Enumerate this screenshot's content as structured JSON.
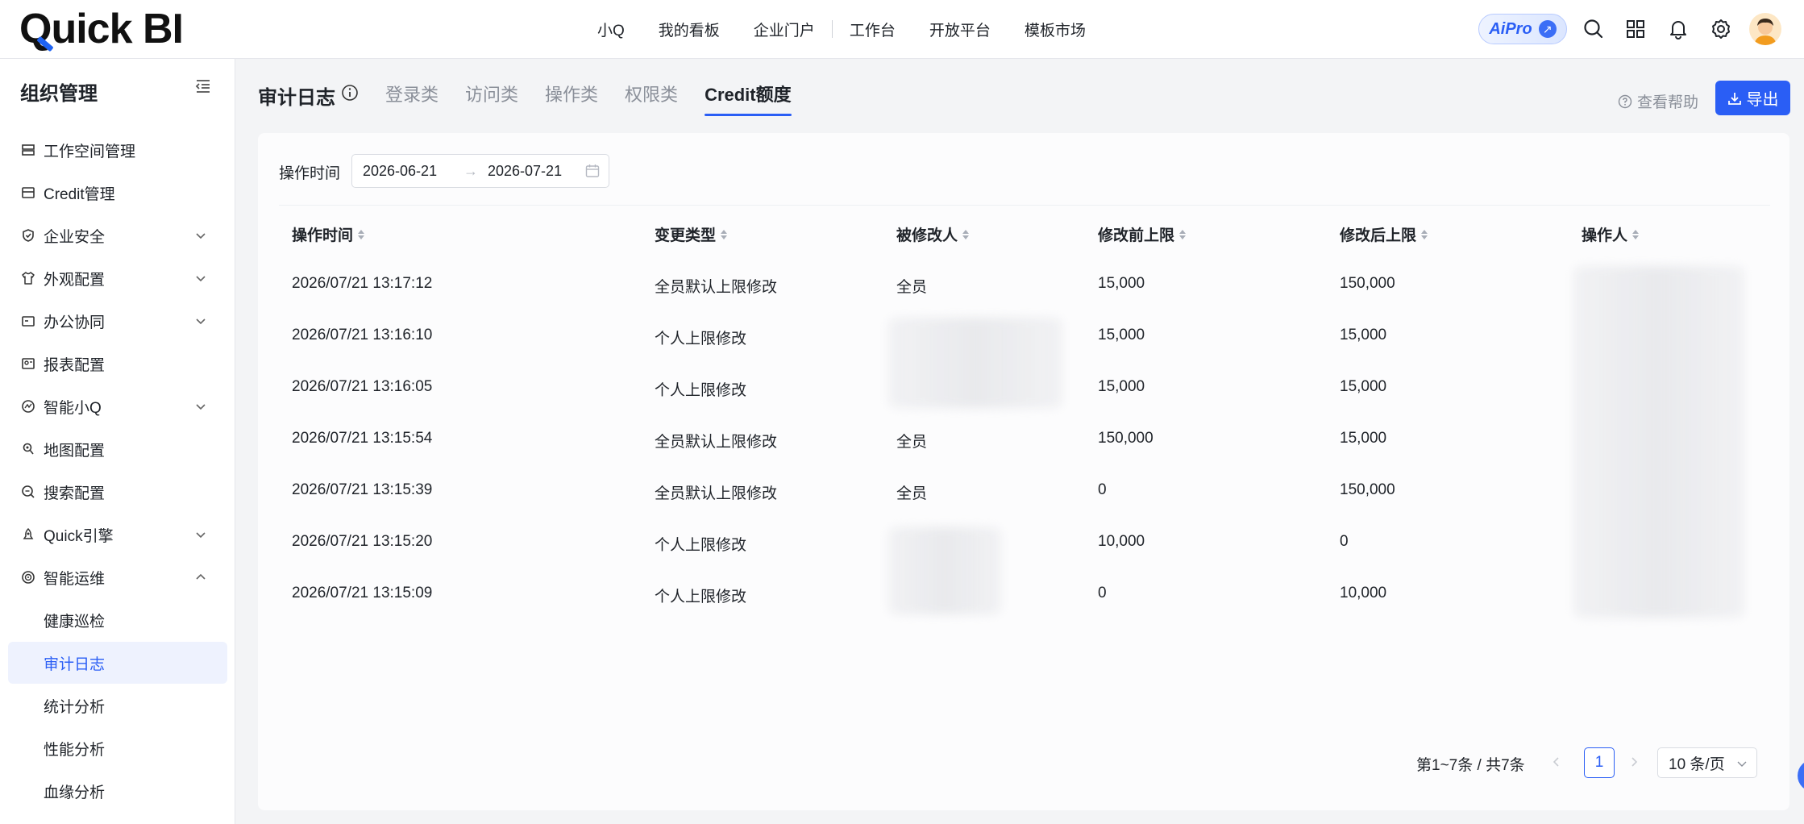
{
  "app": {
    "logo_text": "Quick BI",
    "logo_q": "Q",
    "logo_rest": "uick BI"
  },
  "topnav": {
    "items": [
      "小Q",
      "我的看板",
      "企业门户",
      "工作台",
      "开放平台",
      "模板市场"
    ],
    "ai_pro_label": "AiPro"
  },
  "sidebar": {
    "title": "组织管理",
    "items": [
      {
        "label": "工作空间管理",
        "icon": "workspace-icon",
        "expandable": false
      },
      {
        "label": "Credit管理",
        "icon": "credit-icon",
        "expandable": false
      },
      {
        "label": "企业安全",
        "icon": "shield-icon",
        "expandable": true
      },
      {
        "label": "外观配置",
        "icon": "shirt-icon",
        "expandable": true
      },
      {
        "label": "办公协同",
        "icon": "office-icon",
        "expandable": true
      },
      {
        "label": "报表配置",
        "icon": "report-icon",
        "expandable": false
      },
      {
        "label": "智能小Q",
        "icon": "ai-icon",
        "expandable": true
      },
      {
        "label": "地图配置",
        "icon": "map-pin-icon",
        "expandable": false
      },
      {
        "label": "搜索配置",
        "icon": "search-config-icon",
        "expandable": false
      },
      {
        "label": "Quick引擎",
        "icon": "engine-icon",
        "expandable": true
      },
      {
        "label": "智能运维",
        "icon": "ops-icon",
        "expandable": true,
        "expanded": true
      }
    ],
    "sub_items": [
      "健康巡检",
      "审计日志",
      "统计分析",
      "性能分析",
      "血缘分析"
    ],
    "active_sub": "审计日志"
  },
  "main": {
    "title": "审计日志",
    "tabs": [
      "登录类",
      "访问类",
      "操作类",
      "权限类",
      "Credit额度"
    ],
    "active_tab": "Credit额度",
    "help_label": "查看帮助",
    "export_label": "导出"
  },
  "filter": {
    "label": "操作时间",
    "start_date": "2026-06-21",
    "end_date": "2026-07-21",
    "separator": "→"
  },
  "table": {
    "columns": [
      "操作时间",
      "变更类型",
      "被修改人",
      "修改前上限",
      "修改后上限",
      "操作人"
    ],
    "rows": [
      {
        "time": "2026/07/21 13:17:12",
        "type": "全员默认上限修改",
        "target": "全员",
        "before": "15,000",
        "after": "150,000"
      },
      {
        "time": "2026/07/21 13:16:10",
        "type": "个人上限修改",
        "target": "",
        "before": "15,000",
        "after": "15,000"
      },
      {
        "time": "2026/07/21 13:16:05",
        "type": "个人上限修改",
        "target": "",
        "before": "15,000",
        "after": "15,000"
      },
      {
        "time": "2026/07/21 13:15:54",
        "type": "全员默认上限修改",
        "target": "全员",
        "before": "150,000",
        "after": "15,000"
      },
      {
        "time": "2026/07/21 13:15:39",
        "type": "全员默认上限修改",
        "target": "全员",
        "before": "0",
        "after": "150,000"
      },
      {
        "time": "2026/07/21 13:15:20",
        "type": "个人上限修改",
        "target": "",
        "before": "10,000",
        "after": "0"
      },
      {
        "time": "2026/07/21 13:15:09",
        "type": "个人上限修改",
        "target": "",
        "before": "0",
        "after": "10,000"
      }
    ]
  },
  "pagination": {
    "total_text": "第1~7条 / 共7条",
    "current_page": "1",
    "page_size": "10 条/页"
  },
  "colors": {
    "accent": "#2a5ef5",
    "text": "#1f2329",
    "muted": "#8a8f99"
  }
}
